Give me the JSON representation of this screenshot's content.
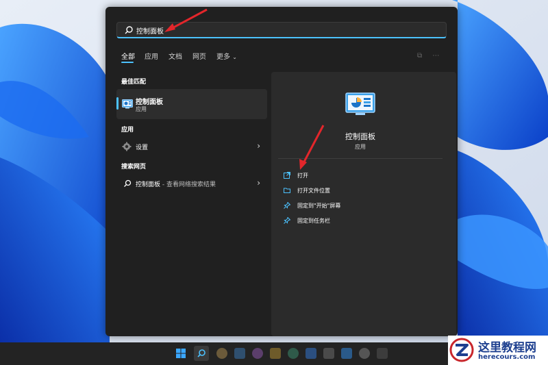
{
  "search": {
    "query": "控制面板"
  },
  "tabs": [
    {
      "label": "全部",
      "active": true
    },
    {
      "label": "应用",
      "active": false
    },
    {
      "label": "文档",
      "active": false
    },
    {
      "label": "网页",
      "active": false
    },
    {
      "label": "更多",
      "active": false
    }
  ],
  "sections": {
    "best_match": "最佳匹配",
    "apps": "应用",
    "web": "搜索网页"
  },
  "best_match": {
    "title": "控制面板",
    "subtitle": "应用"
  },
  "apps": [
    {
      "label": "设置"
    }
  ],
  "web_result": {
    "query": "控制面板",
    "suffix": " - 查看网络搜索结果"
  },
  "detail": {
    "title": "控制面板",
    "subtitle": "应用",
    "actions": [
      {
        "label": "打开",
        "icon": "open-icon"
      },
      {
        "label": "打开文件位置",
        "icon": "folder-icon"
      },
      {
        "label": "固定到\"开始\"屏幕",
        "icon": "pin-icon"
      },
      {
        "label": "固定到任务栏",
        "icon": "pin-icon"
      }
    ]
  },
  "watermark": {
    "title": "这里教程网",
    "url": "herecours.com"
  },
  "colors": {
    "accent": "#4cc2ff",
    "panel": "#202020",
    "arrow": "#e3262b"
  }
}
